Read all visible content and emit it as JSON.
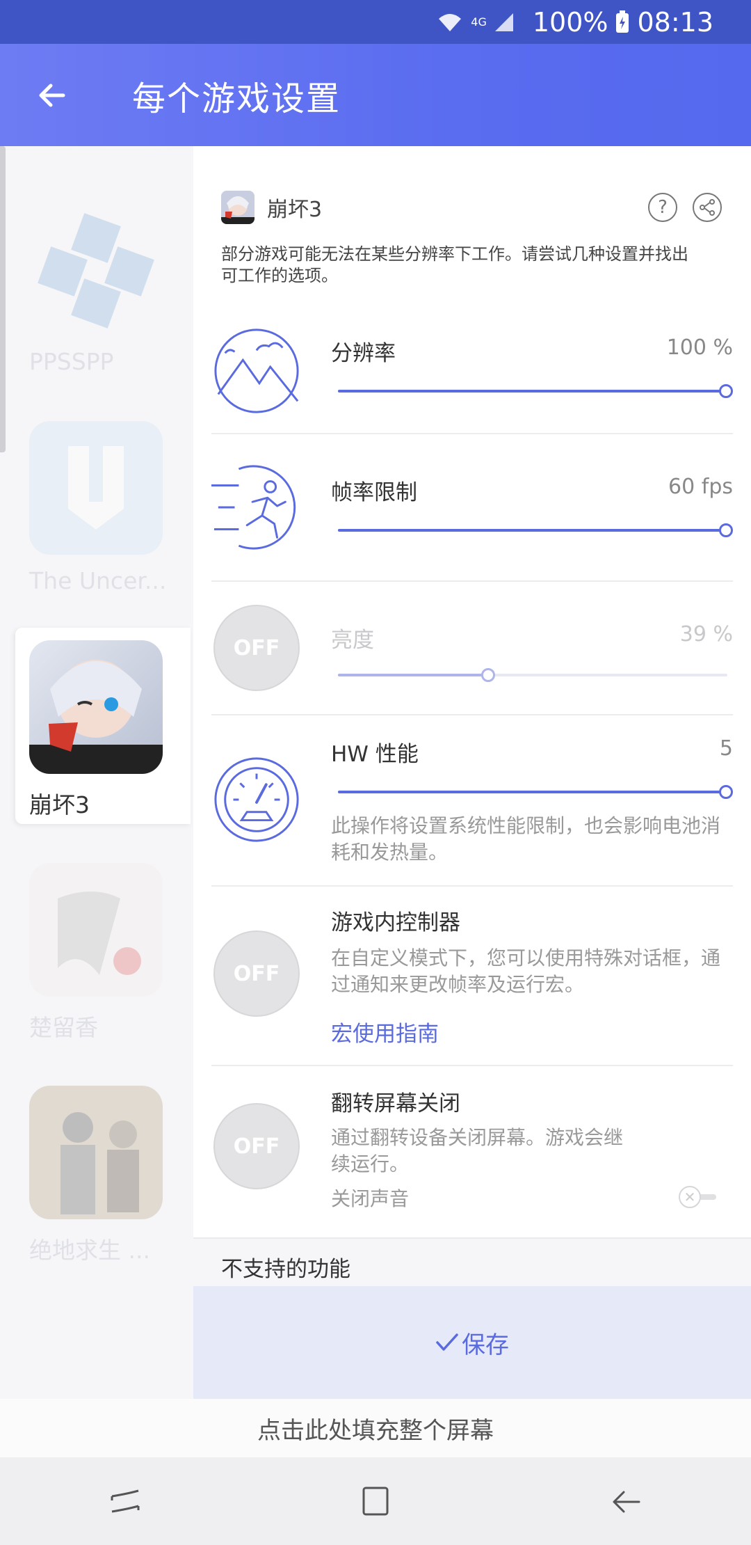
{
  "status_bar": {
    "network": "4G",
    "battery": "100%",
    "time": "08:13"
  },
  "header": {
    "title": "每个游戏设置"
  },
  "games": [
    {
      "name": "PPSSPP"
    },
    {
      "name": "The Uncer..."
    },
    {
      "name": "崩坏3",
      "selected": true
    },
    {
      "name": "楚留香"
    },
    {
      "name": "绝地求生 ..."
    }
  ],
  "panel": {
    "game_name": "崩坏3",
    "description": "部分游戏可能无法在某些分辨率下工作。请尝试几种设置并找出可工作的选项。",
    "resolution": {
      "label": "分辨率",
      "value": "100 %",
      "level": 1.0
    },
    "fps": {
      "label": "帧率限制",
      "value": "60 fps",
      "level": 1.0
    },
    "brightness": {
      "label": "亮度",
      "value": "39 %",
      "level": 0.39,
      "badge": "OFF"
    },
    "hw": {
      "label": "HW 性能",
      "value": "5",
      "level": 1.0,
      "note": "此操作将设置系统性能限制，也会影响电池消耗和发热量。"
    },
    "controller": {
      "label": "游戏内控制器",
      "badge": "OFF",
      "note": "在自定义模式下，您可以使用特殊对话框，通过通知来更改帧率及运行宏。",
      "link": "宏使用指南"
    },
    "flip": {
      "label": "翻转屏幕关闭",
      "badge": "OFF",
      "note": "通过翻转设备关闭屏幕。游戏会继续运行。",
      "mute": "关闭声音"
    }
  },
  "unsupported": {
    "label": "不支持的功能"
  },
  "save": {
    "label": "保存"
  },
  "fill_screen": {
    "label": "点击此处填充整个屏幕"
  }
}
